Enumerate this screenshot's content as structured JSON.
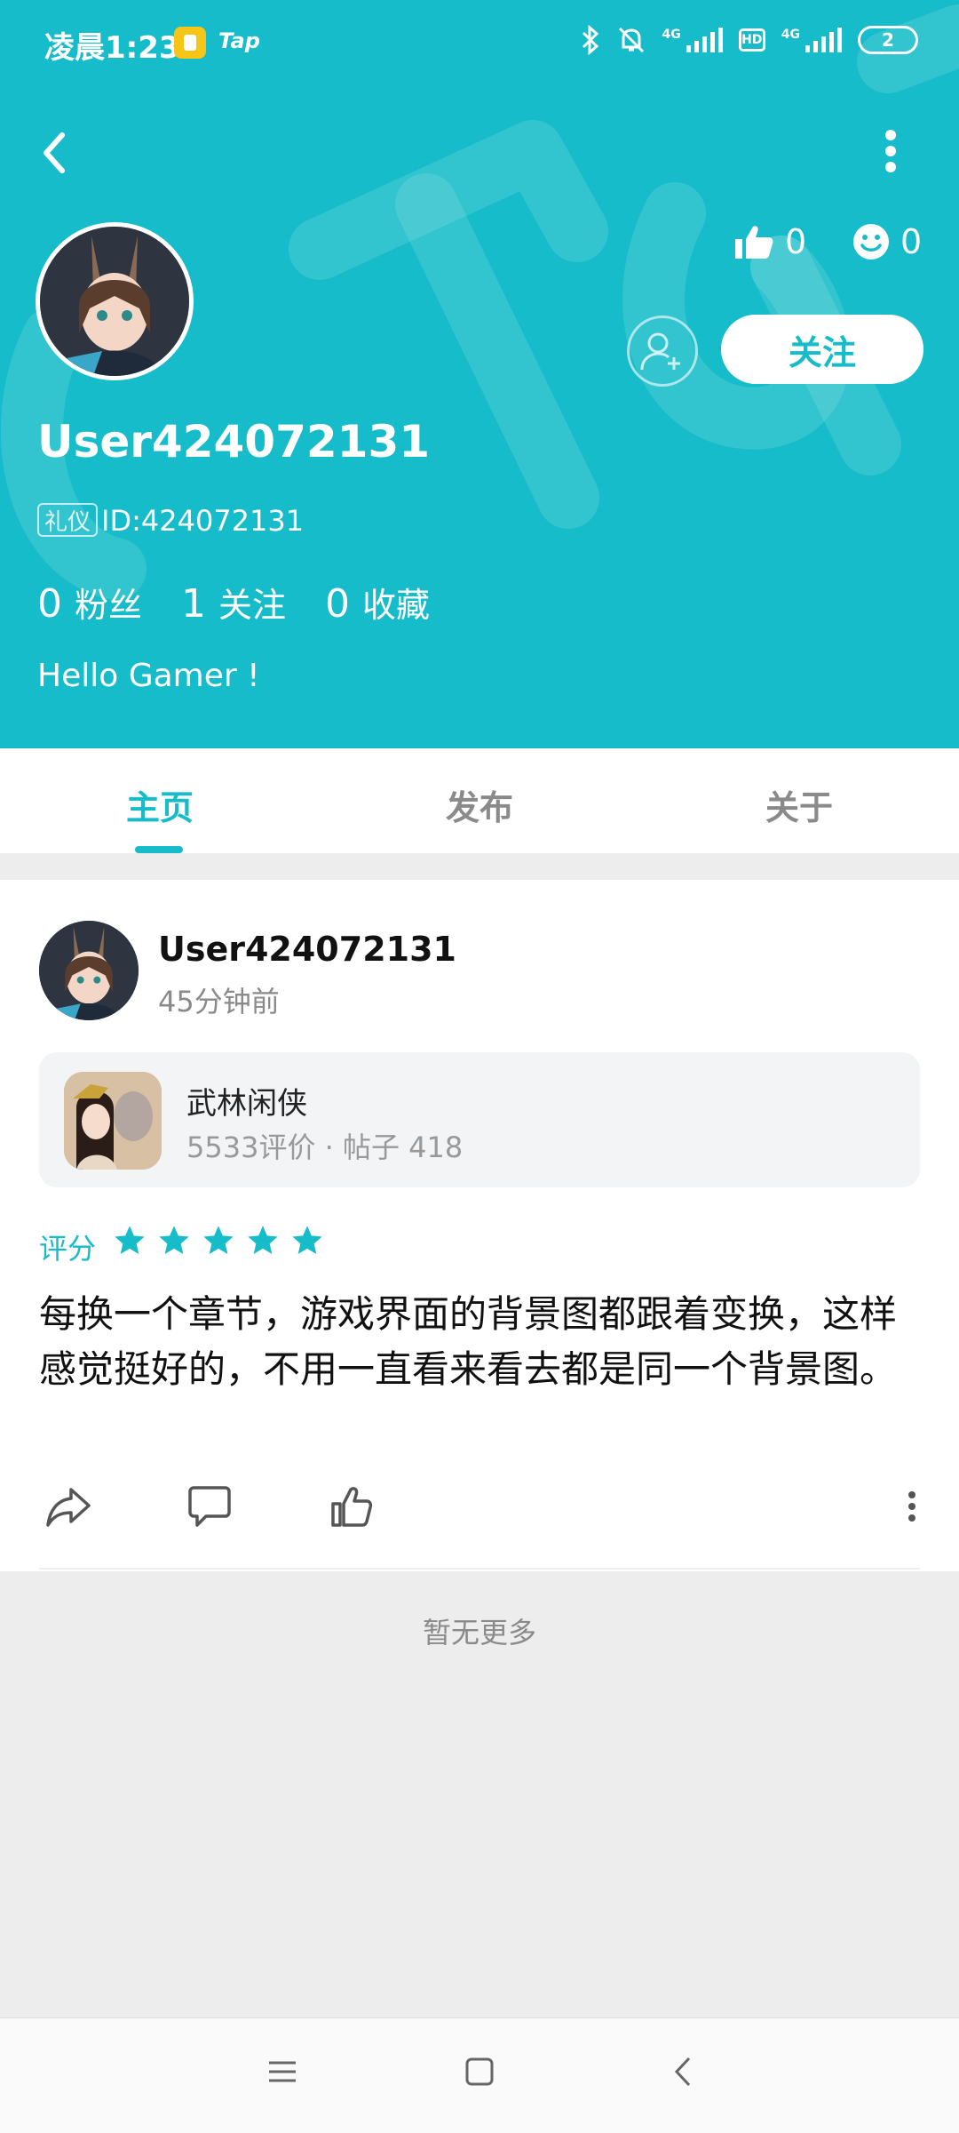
{
  "status_bar": {
    "time": "凌晨1:23",
    "app_label": "Tap",
    "net1": "4G",
    "net2": "4G",
    "hd": "HD",
    "battery": "2"
  },
  "profile": {
    "username": "User424072131",
    "badge": "礼仪",
    "user_id": "ID:424072131",
    "likes": "0",
    "smiles": "0",
    "follow_label": "关注",
    "fans_count": "0",
    "fans_label": "粉丝",
    "following_count": "1",
    "following_label": "关注",
    "favorites_count": "0",
    "favorites_label": "收藏",
    "bio": "Hello Gamer !"
  },
  "tabs": [
    {
      "label": "主页",
      "active": true
    },
    {
      "label": "发布",
      "active": false
    },
    {
      "label": "关于",
      "active": false
    }
  ],
  "post": {
    "username": "User424072131",
    "time": "45分钟前",
    "game_name": "武林闲侠",
    "game_meta": "5533评价 · 帖子 418",
    "rating_label": "评分",
    "rating": 5,
    "rating_max": 5,
    "text": "每换一个章节，游戏界面的背景图都跟着变换，这样感觉挺好的，不用一直看来看去都是同一个背景图。"
  },
  "footer_text": "暂无更多",
  "colors": {
    "accent": "#16bcc9",
    "background": "#ededed"
  }
}
